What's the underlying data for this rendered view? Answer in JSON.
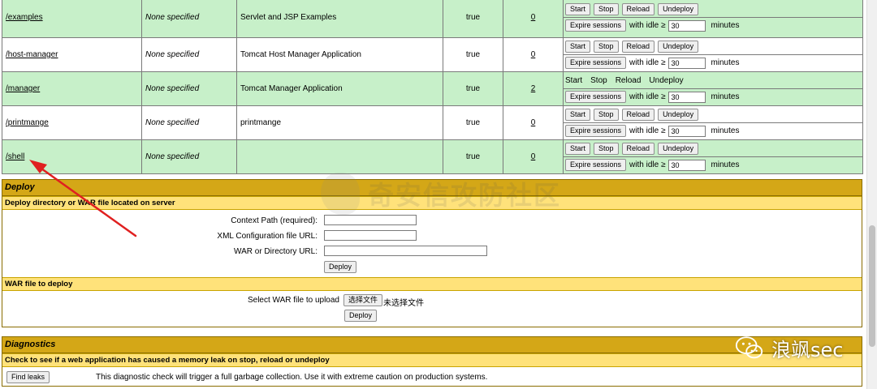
{
  "apps": {
    "rows": [
      {
        "path": "/examples",
        "display": "None specified",
        "description": "Servlet and JSP Examples",
        "running": "true",
        "sessions": "0",
        "bg": "green",
        "all_buttons": true
      },
      {
        "path": "/host-manager",
        "display": "None specified",
        "description": "Tomcat Host Manager Application",
        "running": "true",
        "sessions": "0",
        "bg": "white",
        "all_buttons": true
      },
      {
        "path": "/manager",
        "display": "None specified",
        "description": "Tomcat Manager Application",
        "running": "true",
        "sessions": "2",
        "bg": "green",
        "all_buttons": false
      },
      {
        "path": "/printmange",
        "display": "None specified",
        "description": "printmange",
        "running": "true",
        "sessions": "0",
        "bg": "white",
        "all_buttons": true
      },
      {
        "path": "/shell",
        "display": "None specified",
        "description": "",
        "running": "true",
        "sessions": "0",
        "bg": "green",
        "all_buttons": true
      }
    ],
    "commands": {
      "start": "Start",
      "stop": "Stop",
      "reload": "Reload",
      "undeploy": "Undeploy",
      "expire": "Expire sessions",
      "with_idle": "with idle ≥",
      "idle_value": "30",
      "minutes": "minutes"
    }
  },
  "deploy": {
    "title": "Deploy",
    "dir_subtitle": "Deploy directory or WAR file located on server",
    "context_path_label": "Context Path (required):",
    "xml_config_label": "XML Configuration file URL:",
    "war_dir_label": "WAR or Directory URL:",
    "deploy_button": "Deploy",
    "war_subtitle": "WAR file to deploy",
    "select_war_label": "Select WAR file to upload",
    "choose_file_button": "选择文件",
    "no_file_text": "未选择文件",
    "deploy_button2": "Deploy"
  },
  "diagnostics": {
    "title": "Diagnostics",
    "subtitle": "Check to see if a web application has caused a memory leak on stop, reload or undeploy",
    "find_leaks_button": "Find leaks",
    "find_leaks_desc": "This diagnostic check will trigger a full garbage collection. Use it with extreme caution on production systems."
  },
  "overlay": {
    "watermark_text": "奇安信攻防社区",
    "brand_text": "浪飒sec",
    "arrow_color": "#e02020"
  }
}
